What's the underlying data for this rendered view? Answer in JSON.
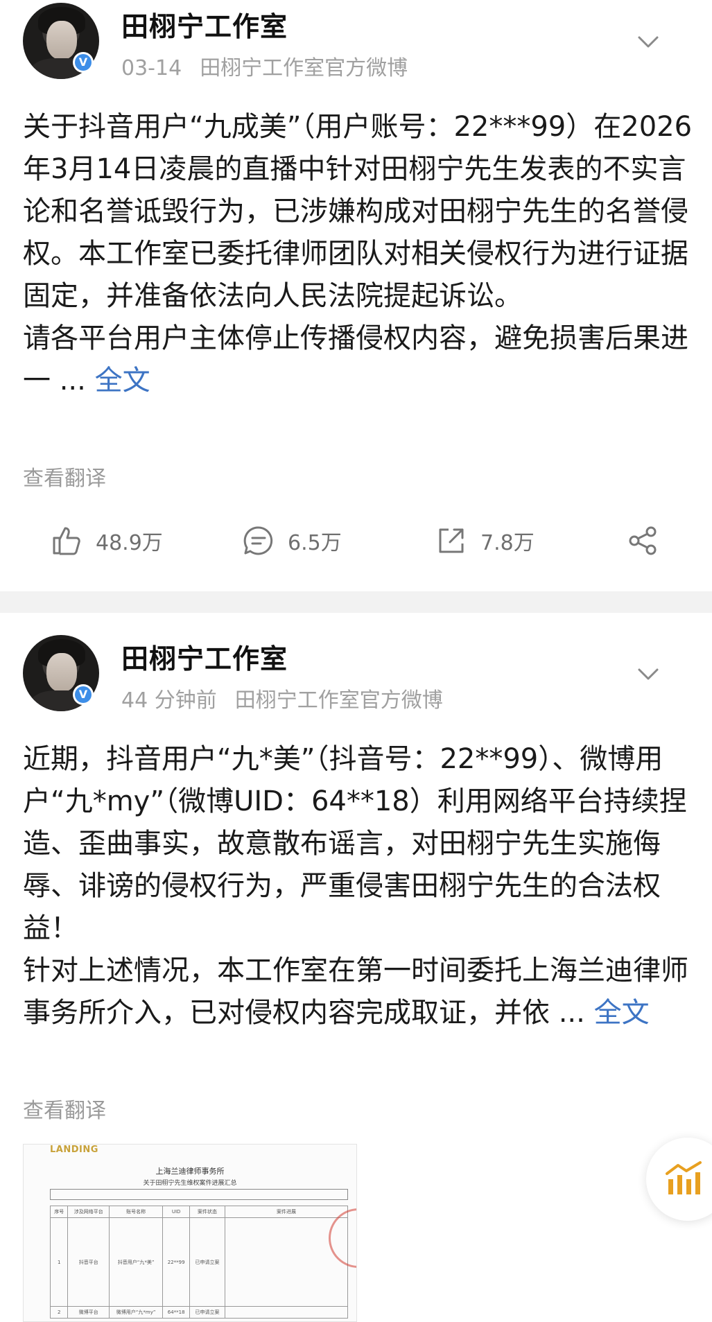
{
  "post1": {
    "account_name": "田栩宁工作室",
    "date": "03-14",
    "source": "田栩宁工作室官方微博",
    "verified_badge": "V",
    "paragraph1": "关于抖音用户“九成美”（用户账号：22***99）在2026年3月14日凌晨的直播中针对田栩宁先生发表的不实言论和名誉诋毁行为，已涉嫌构成对田栩宁先生的名誉侵权。本工作室已委托律师团队对相关侵权行为进行证据固定，并准备依法向人民法院提起诉讼。",
    "paragraph2_prefix": "请各平台用户主体停止传播侵权内容，避免损害后果进一 ...",
    "full_text_link": "全文",
    "translate_label": "查看翻译",
    "likes": "48.9万",
    "comments": "6.5万",
    "reposts": "7.8万"
  },
  "post2": {
    "account_name": "田栩宁工作室",
    "time": "44 分钟前",
    "source": "田栩宁工作室官方微博",
    "verified_badge": "V",
    "paragraph1": "近期，抖音用户“九*美”（抖音号：22**99）、微博用户“九*my”（微博UID：64**18）利用网络平台持续捏造、歪曲事实，故意散布谣言，对田栩宁先生实施侮辱、诽谤的侵权行为，严重侵害田栩宁先生的合法权益！",
    "paragraph2_prefix": "针对上述情况，本工作室在第一时间委托上海兰迪律师事务所介入，已对侵权内容完成取证，并依 ...",
    "full_text_link": "全文",
    "translate_label": "查看翻译",
    "attachment": {
      "logo": "LANDING",
      "title": "上海兰迪律师事务所",
      "subtitle": "关于田栩宁先生维权案件进展汇总",
      "headers": [
        "序号",
        "涉及网络平台",
        "账号名称",
        "UID",
        "案件状态",
        "案件进展"
      ],
      "row1": [
        "1",
        "抖音平台",
        "抖音用户“九*美”",
        "22**99",
        "已申请立案",
        ""
      ],
      "row2": [
        "2",
        "微博平台",
        "微博用户“九*my”",
        "64**18",
        "已申请立案",
        ""
      ]
    }
  },
  "colors": {
    "link": "#3d74c4",
    "meta": "#a0a0a0",
    "badge": "#3d8ee8",
    "float_icon": "#e8a020"
  }
}
